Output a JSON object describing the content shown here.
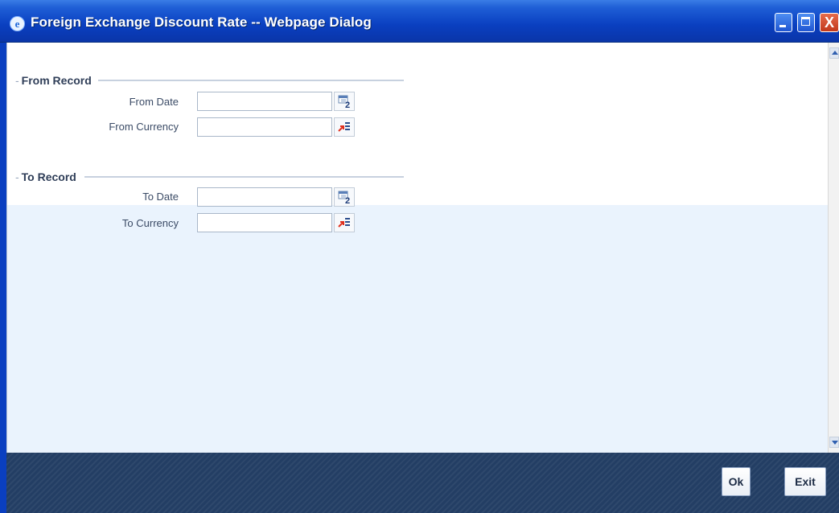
{
  "window": {
    "title": "Foreign Exchange Discount Rate -- Webpage Dialog",
    "title_icon": "internet-explorer-icon",
    "controls": [
      "minimize-icon",
      "maximize-icon",
      "close-icon"
    ]
  },
  "from_record": {
    "heading": "From Record",
    "date_label": "From Date",
    "date_value": "",
    "date_icon": "calendar-icon",
    "currency_label": "From Currency",
    "currency_value": "",
    "currency_icon": "list-of-values-icon"
  },
  "to_record": {
    "heading": "To Record",
    "date_label": "To Date",
    "date_value": "",
    "date_icon": "calendar-icon",
    "currency_label": "To Currency",
    "currency_value": "",
    "currency_icon": "list-of-values-icon"
  },
  "footer": {
    "ok_label": "Ok",
    "exit_label": "Exit"
  },
  "colors": {
    "titlebar": "#0a3fc0",
    "footer": "#233e64",
    "lower_panel": "#eaf3fd"
  }
}
